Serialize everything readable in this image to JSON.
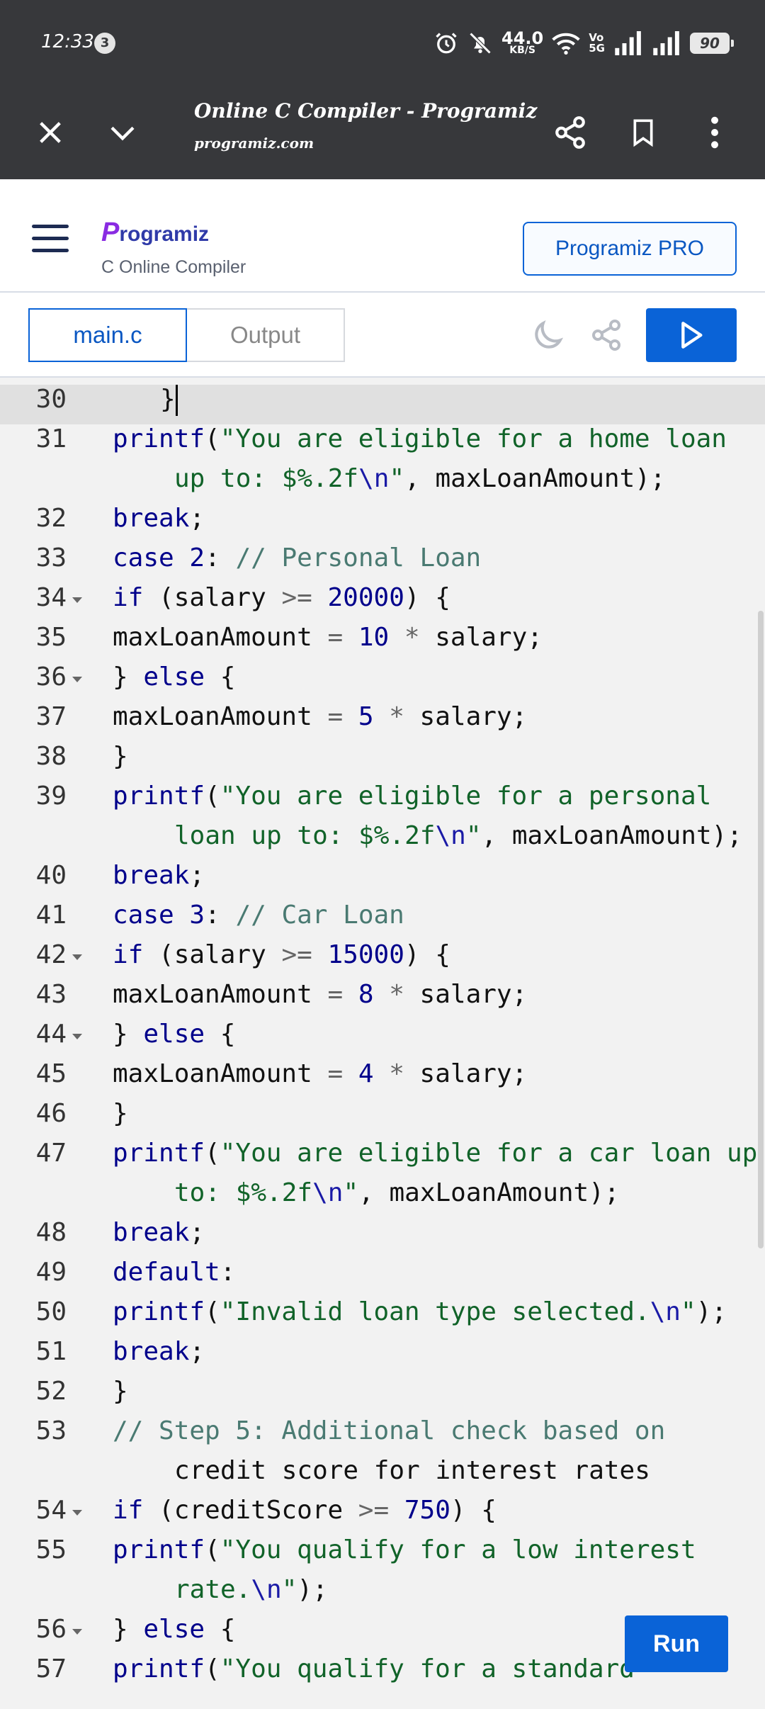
{
  "status": {
    "time": "12:33",
    "badge": "3",
    "net_speed": "44.0",
    "net_unit": "KB/S",
    "volte": "Vo",
    "volte2": "5G",
    "battery": "90"
  },
  "browser": {
    "title": "Online C Compiler - Programiz",
    "url": "programiz.com"
  },
  "site": {
    "logo": "rogramiz",
    "logo_p": "P",
    "subtitle": "C Online Compiler",
    "pro_button": "Programiz PRO"
  },
  "tabs": {
    "main": "main.c",
    "output": "Output"
  },
  "run_label": "Run",
  "colors": {
    "accent": "#0a63d7",
    "toolbar": "#37383b"
  },
  "code_lines": [
    {
      "n": "30",
      "text": "}"
    },
    {
      "n": "31",
      "text": "printf(\"You are eligible for a home loan",
      "wrap": "up to: $%.2f\\n\", maxLoanAmount);"
    },
    {
      "n": "32",
      "text": "break;"
    },
    {
      "n": "33",
      "text": "case 2: // Personal Loan"
    },
    {
      "n": "34",
      "text": "if (salary >= 20000) {"
    },
    {
      "n": "35",
      "text": "maxLoanAmount = 10 * salary;"
    },
    {
      "n": "36",
      "text": "} else {"
    },
    {
      "n": "37",
      "text": "maxLoanAmount = 5 * salary;"
    },
    {
      "n": "38",
      "text": "}"
    },
    {
      "n": "39",
      "text": "printf(\"You are eligible for a personal",
      "wrap": "loan up to: $%.2f\\n\", maxLoanAmount);"
    },
    {
      "n": "40",
      "text": "break;"
    },
    {
      "n": "41",
      "text": "case 3: // Car Loan"
    },
    {
      "n": "42",
      "text": "if (salary >= 15000) {"
    },
    {
      "n": "43",
      "text": "maxLoanAmount = 8 * salary;"
    },
    {
      "n": "44",
      "text": "} else {"
    },
    {
      "n": "45",
      "text": "maxLoanAmount = 4 * salary;"
    },
    {
      "n": "46",
      "text": "}"
    },
    {
      "n": "47",
      "text": "printf(\"You are eligible for a car loan up",
      "wrap": "to: $%.2f\\n\", maxLoanAmount);"
    },
    {
      "n": "48",
      "text": "break;"
    },
    {
      "n": "49",
      "text": "default:"
    },
    {
      "n": "50",
      "text": "printf(\"Invalid loan type selected.\\n\");"
    },
    {
      "n": "51",
      "text": "break;"
    },
    {
      "n": "52",
      "text": "}"
    },
    {
      "n": "53",
      "text": "// Step 5: Additional check based on",
      "wrap": "credit score for interest rates"
    },
    {
      "n": "54",
      "text": "if (creditScore >= 750) {"
    },
    {
      "n": "55",
      "text": "printf(\"You qualify for a low interest",
      "wrap": "rate.\\n\");"
    },
    {
      "n": "56",
      "text": "} else {"
    },
    {
      "n": "57",
      "text": "printf(\"You qualify for a standard"
    }
  ]
}
